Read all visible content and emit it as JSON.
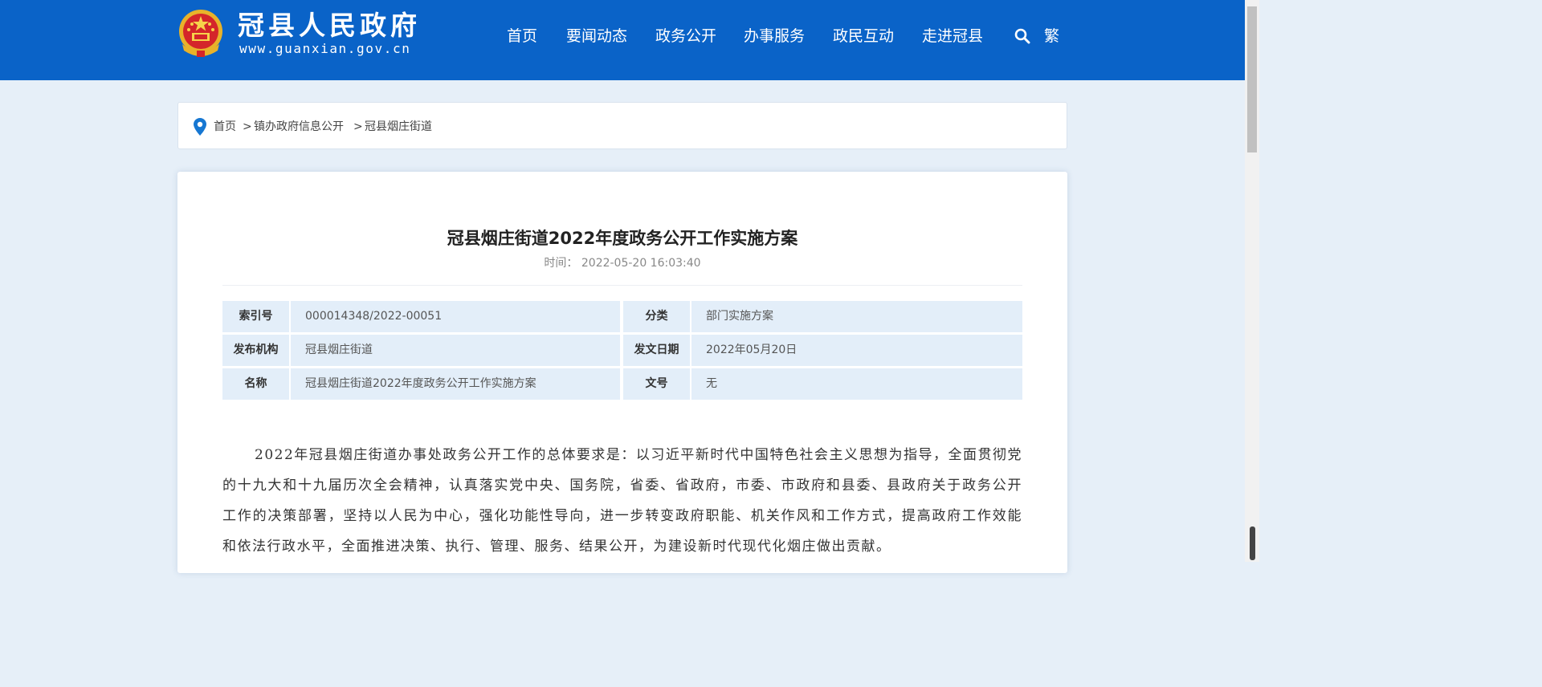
{
  "header": {
    "site_name": "冠县人民政府",
    "site_url": "www.guanxian.gov.cn",
    "brand_color": "#0a63c8",
    "nav": [
      "首页",
      "要闻动态",
      "政务公开",
      "办事服务",
      "政民互动",
      "走进冠县"
    ],
    "search_icon": "search-icon",
    "traditional_label": "繁"
  },
  "breadcrumb": {
    "icon": "location-pin-icon",
    "items": [
      "首页",
      "镇办政府信息公开",
      "冠县烟庄街道"
    ],
    "separator": ">"
  },
  "article": {
    "title": "冠县烟庄街道2022年度政务公开工作实施方案",
    "time_label": "时间：",
    "time_value": "2022-05-20 16:03:40",
    "meta": [
      {
        "k1": "索引号",
        "v1": "000014348/2022-00051",
        "k2": "分类",
        "v2": "部门实施方案"
      },
      {
        "k1": "发布机构",
        "v1": "冠县烟庄街道",
        "k2": "发文日期",
        "v2": "2022年05月20日"
      },
      {
        "k1": "名称",
        "v1": "冠县烟庄街道2022年度政务公开工作实施方案",
        "k2": "文号",
        "v2": "无"
      }
    ],
    "body": "2022年冠县烟庄街道办事处政务公开工作的总体要求是：以习近平新时代中国特色社会主义思想为指导，全面贯彻党的十九大和十九届历次全会精神，认真落实党中央、国务院，省委、省政府，市委、市政府和县委、县政府关于政务公开工作的决策部署，坚持以人民为中心，强化功能性导向，进一步转变政府职能、机关作风和工作方式，提高政府工作效能和依法行政水平，全面推进决策、执行、管理、服务、结果公开，为建设新时代现代化烟庄做出贡献。"
  }
}
